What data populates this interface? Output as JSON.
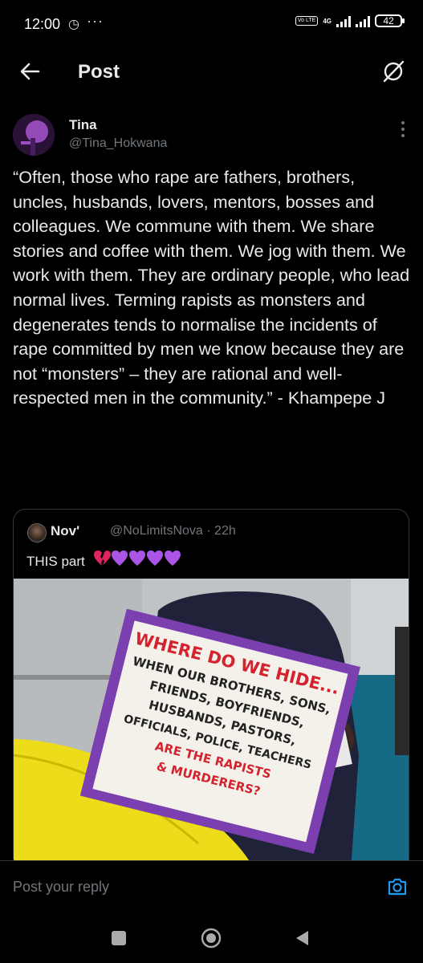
{
  "status_bar": {
    "time": "12:00",
    "alarm_icon": "alarm-icon",
    "overflow": "···",
    "volte": "Vo LTE",
    "network": "4G",
    "battery": "42"
  },
  "header": {
    "title": "Post",
    "back_icon": "back-arrow-icon",
    "grok_icon": "grok-icon"
  },
  "post": {
    "author_name": "Tina",
    "author_handle": "@Tina_Hokwana",
    "text": "“Often, those who rape are fathers, brothers, uncles, husbands, lovers, mentors, bosses and colleagues.  We commune with them.  We share stories and coffee with them.  We jog with them.  We work with them.  They are ordinary people, who lead normal lives.  Terming rapists as monsters and degenerates tends to normalise the incidents of rape committed by men we know because they are not “monsters” – they are rational and well-respected men in the community.” - Khampepe J"
  },
  "quote": {
    "author_name": "Nov'",
    "author_handle": "@NoLimitsNova · 22h",
    "text": "THIS part",
    "emojis": "💔💜💜💜💜",
    "sign_text": [
      "WHERE DO WE HIDE...",
      "WHEN OUR BROTHERS, SONS,",
      "FRIENDS, BOYFRIENDS,",
      "HUSBANDS, PASTORS,",
      "OFFICIALS, POLICE, TEACHERS",
      "ARE THE RAPISTS",
      "& MURDERERS?"
    ]
  },
  "reply": {
    "placeholder": "Post your reply",
    "camera_icon": "camera-icon"
  },
  "colors": {
    "background": "#000000",
    "text": "#e7e9ea",
    "muted": "#71767b",
    "accent": "#1d9bf0"
  }
}
